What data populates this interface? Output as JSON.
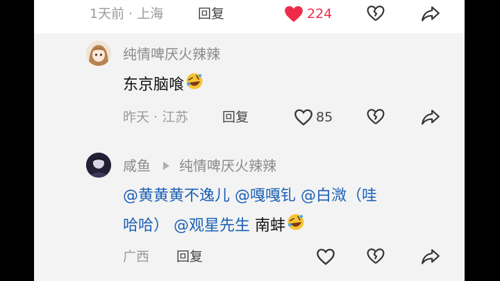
{
  "top_comment": {
    "time_location": "1天前 · 上海",
    "reply_label": "回复",
    "like_count": "224",
    "like_color": "#ee2c4a"
  },
  "replies": [
    {
      "author": "纯情啤厌火辣辣",
      "text": "东京脑喰",
      "emoji": "rolling-on-floor-laughing-emoji",
      "time_location": "昨天 · 江苏",
      "reply_label": "回复",
      "like_count": "85"
    },
    {
      "author": "咸鱼",
      "reply_to": "纯情啤厌火辣辣",
      "text_line1": "@黄黄黄不逸儿 @嘎嘎钆 @白溦（哇",
      "text_line2_mentions": "哈哈） @观星先生",
      "text_line2_tail": " 南蚌",
      "emoji": "rolling-on-floor-laughing-emoji",
      "location": "广西",
      "reply_label": "回复"
    }
  ],
  "colors": {
    "mention": "#1a5fb4",
    "meta": "#9a9a9a",
    "icon": "#333333"
  }
}
